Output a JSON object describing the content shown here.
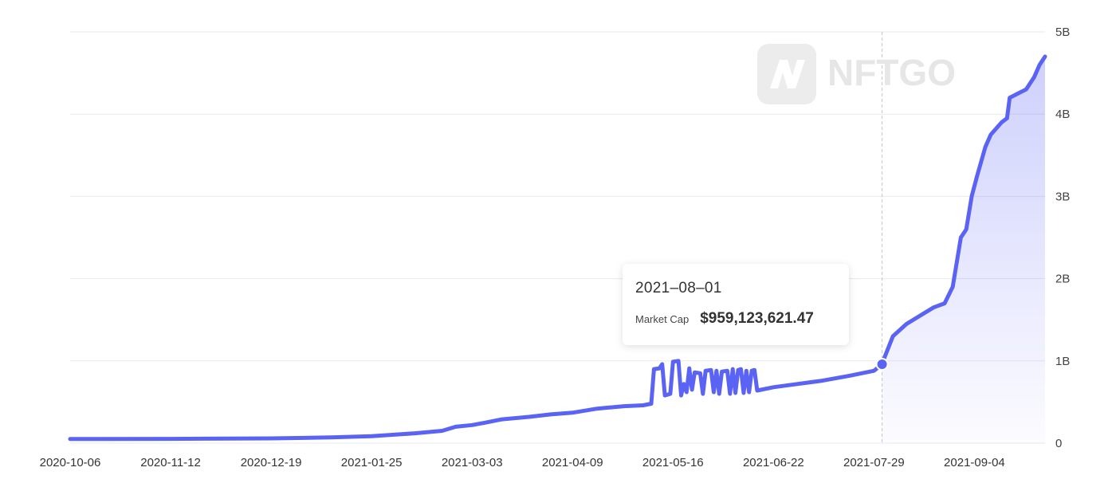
{
  "chart_data": {
    "type": "area",
    "title": "",
    "xlabel": "",
    "ylabel": "",
    "x_ticks": [
      "2020-10-06",
      "2020-11-12",
      "2020-12-19",
      "2021-01-25",
      "2021-03-03",
      "2021-04-09",
      "2021-05-16",
      "2021-06-22",
      "2021-07-29",
      "2021-09-04"
    ],
    "x_range": [
      "2020-10-06",
      "2021-09-30"
    ],
    "y_ticks": [
      0,
      1000000000,
      2000000000,
      3000000000,
      4000000000,
      5000000000
    ],
    "y_tick_labels": [
      "0",
      "1B",
      "2B",
      "3B",
      "4B",
      "5B"
    ],
    "ylim": [
      0,
      5000000000
    ],
    "y_axis_position": "right",
    "grid": "horizontal",
    "series": [
      {
        "color": "#5b63f5",
        "points": [
          [
            "2020-10-06",
            50000000
          ],
          [
            "2020-11-12",
            52000000
          ],
          [
            "2020-12-19",
            58000000
          ],
          [
            "2021-01-10",
            70000000
          ],
          [
            "2021-01-25",
            85000000
          ],
          [
            "2021-02-10",
            120000000
          ],
          [
            "2021-02-20",
            150000000
          ],
          [
            "2021-02-25",
            200000000
          ],
          [
            "2021-03-03",
            220000000
          ],
          [
            "2021-03-08",
            250000000
          ],
          [
            "2021-03-14",
            290000000
          ],
          [
            "2021-03-24",
            320000000
          ],
          [
            "2021-04-01",
            350000000
          ],
          [
            "2021-04-09",
            370000000
          ],
          [
            "2021-04-18",
            420000000
          ],
          [
            "2021-04-28",
            450000000
          ],
          [
            "2021-05-05",
            460000000
          ],
          [
            "2021-05-08",
            480000000
          ],
          [
            "2021-05-09",
            900000000
          ],
          [
            "2021-05-11",
            910000000
          ],
          [
            "2021-05-12",
            960000000
          ],
          [
            "2021-05-13",
            580000000
          ],
          [
            "2021-05-15",
            600000000
          ],
          [
            "2021-05-16",
            990000000
          ],
          [
            "2021-05-18",
            1000000000
          ],
          [
            "2021-05-19",
            580000000
          ],
          [
            "2021-05-20",
            720000000
          ],
          [
            "2021-05-21",
            620000000
          ],
          [
            "2021-05-22",
            910000000
          ],
          [
            "2021-05-23",
            650000000
          ],
          [
            "2021-05-24",
            860000000
          ],
          [
            "2021-05-26",
            850000000
          ],
          [
            "2021-05-27",
            600000000
          ],
          [
            "2021-05-28",
            880000000
          ],
          [
            "2021-05-30",
            890000000
          ],
          [
            "2021-05-31",
            620000000
          ],
          [
            "2021-06-01",
            880000000
          ],
          [
            "2021-06-02",
            600000000
          ],
          [
            "2021-06-03",
            870000000
          ],
          [
            "2021-06-05",
            880000000
          ],
          [
            "2021-06-06",
            600000000
          ],
          [
            "2021-06-07",
            900000000
          ],
          [
            "2021-06-08",
            610000000
          ],
          [
            "2021-06-09",
            890000000
          ],
          [
            "2021-06-10",
            900000000
          ],
          [
            "2021-06-11",
            610000000
          ],
          [
            "2021-06-12",
            880000000
          ],
          [
            "2021-06-13",
            620000000
          ],
          [
            "2021-06-14",
            880000000
          ],
          [
            "2021-06-15",
            890000000
          ],
          [
            "2021-06-16",
            640000000
          ],
          [
            "2021-06-22",
            680000000
          ],
          [
            "2021-07-01",
            720000000
          ],
          [
            "2021-07-10",
            760000000
          ],
          [
            "2021-07-20",
            820000000
          ],
          [
            "2021-07-29",
            880000000
          ],
          [
            "2021-08-01",
            959123621
          ],
          [
            "2021-08-02",
            1050000000
          ],
          [
            "2021-08-05",
            1300000000
          ],
          [
            "2021-08-10",
            1450000000
          ],
          [
            "2021-08-15",
            1550000000
          ],
          [
            "2021-08-20",
            1650000000
          ],
          [
            "2021-08-24",
            1700000000
          ],
          [
            "2021-08-27",
            1900000000
          ],
          [
            "2021-08-30",
            2500000000
          ],
          [
            "2021-09-01",
            2600000000
          ],
          [
            "2021-09-03",
            3000000000
          ],
          [
            "2021-09-05",
            3250000000
          ],
          [
            "2021-09-08",
            3600000000
          ],
          [
            "2021-09-10",
            3750000000
          ],
          [
            "2021-09-14",
            3900000000
          ],
          [
            "2021-09-16",
            3950000000
          ],
          [
            "2021-09-17",
            4200000000
          ],
          [
            "2021-09-20",
            4250000000
          ],
          [
            "2021-09-23",
            4300000000
          ],
          [
            "2021-09-24",
            4350000000
          ],
          [
            "2021-09-26",
            4450000000
          ],
          [
            "2021-09-28",
            4600000000
          ],
          [
            "2021-09-30",
            4700000000
          ]
        ]
      }
    ],
    "tooltip": {
      "date": "2021–08–01",
      "label": "Market Cap",
      "value": "$959,123,621.47",
      "x": "2021-08-01",
      "y": 959123621
    },
    "watermark": "NFTGO"
  }
}
